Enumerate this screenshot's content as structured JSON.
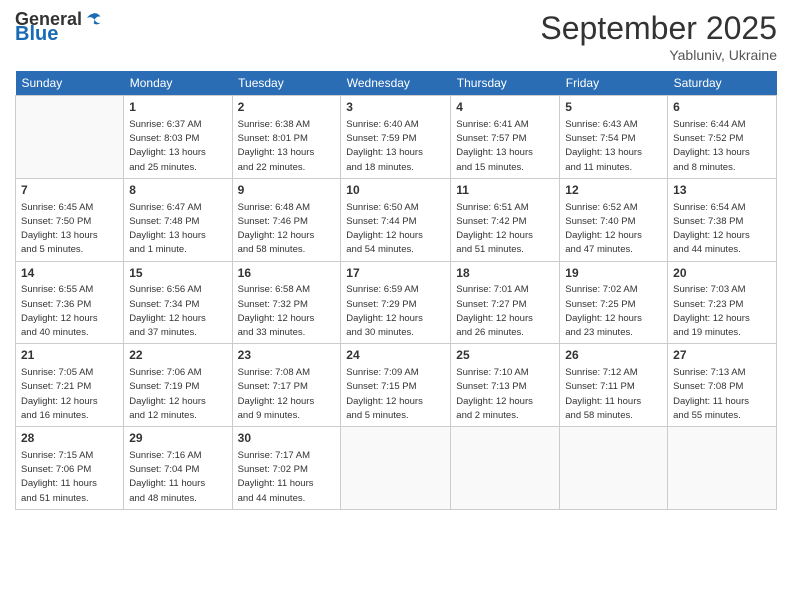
{
  "header": {
    "logo_general": "General",
    "logo_blue": "Blue",
    "month_title": "September 2025",
    "subtitle": "Yabluniv, Ukraine"
  },
  "columns": [
    "Sunday",
    "Monday",
    "Tuesday",
    "Wednesday",
    "Thursday",
    "Friday",
    "Saturday"
  ],
  "weeks": [
    [
      {
        "day": "",
        "info": ""
      },
      {
        "day": "1",
        "info": "Sunrise: 6:37 AM\nSunset: 8:03 PM\nDaylight: 13 hours\nand 25 minutes."
      },
      {
        "day": "2",
        "info": "Sunrise: 6:38 AM\nSunset: 8:01 PM\nDaylight: 13 hours\nand 22 minutes."
      },
      {
        "day": "3",
        "info": "Sunrise: 6:40 AM\nSunset: 7:59 PM\nDaylight: 13 hours\nand 18 minutes."
      },
      {
        "day": "4",
        "info": "Sunrise: 6:41 AM\nSunset: 7:57 PM\nDaylight: 13 hours\nand 15 minutes."
      },
      {
        "day": "5",
        "info": "Sunrise: 6:43 AM\nSunset: 7:54 PM\nDaylight: 13 hours\nand 11 minutes."
      },
      {
        "day": "6",
        "info": "Sunrise: 6:44 AM\nSunset: 7:52 PM\nDaylight: 13 hours\nand 8 minutes."
      }
    ],
    [
      {
        "day": "7",
        "info": "Sunrise: 6:45 AM\nSunset: 7:50 PM\nDaylight: 13 hours\nand 5 minutes."
      },
      {
        "day": "8",
        "info": "Sunrise: 6:47 AM\nSunset: 7:48 PM\nDaylight: 13 hours\nand 1 minute."
      },
      {
        "day": "9",
        "info": "Sunrise: 6:48 AM\nSunset: 7:46 PM\nDaylight: 12 hours\nand 58 minutes."
      },
      {
        "day": "10",
        "info": "Sunrise: 6:50 AM\nSunset: 7:44 PM\nDaylight: 12 hours\nand 54 minutes."
      },
      {
        "day": "11",
        "info": "Sunrise: 6:51 AM\nSunset: 7:42 PM\nDaylight: 12 hours\nand 51 minutes."
      },
      {
        "day": "12",
        "info": "Sunrise: 6:52 AM\nSunset: 7:40 PM\nDaylight: 12 hours\nand 47 minutes."
      },
      {
        "day": "13",
        "info": "Sunrise: 6:54 AM\nSunset: 7:38 PM\nDaylight: 12 hours\nand 44 minutes."
      }
    ],
    [
      {
        "day": "14",
        "info": "Sunrise: 6:55 AM\nSunset: 7:36 PM\nDaylight: 12 hours\nand 40 minutes."
      },
      {
        "day": "15",
        "info": "Sunrise: 6:56 AM\nSunset: 7:34 PM\nDaylight: 12 hours\nand 37 minutes."
      },
      {
        "day": "16",
        "info": "Sunrise: 6:58 AM\nSunset: 7:32 PM\nDaylight: 12 hours\nand 33 minutes."
      },
      {
        "day": "17",
        "info": "Sunrise: 6:59 AM\nSunset: 7:29 PM\nDaylight: 12 hours\nand 30 minutes."
      },
      {
        "day": "18",
        "info": "Sunrise: 7:01 AM\nSunset: 7:27 PM\nDaylight: 12 hours\nand 26 minutes."
      },
      {
        "day": "19",
        "info": "Sunrise: 7:02 AM\nSunset: 7:25 PM\nDaylight: 12 hours\nand 23 minutes."
      },
      {
        "day": "20",
        "info": "Sunrise: 7:03 AM\nSunset: 7:23 PM\nDaylight: 12 hours\nand 19 minutes."
      }
    ],
    [
      {
        "day": "21",
        "info": "Sunrise: 7:05 AM\nSunset: 7:21 PM\nDaylight: 12 hours\nand 16 minutes."
      },
      {
        "day": "22",
        "info": "Sunrise: 7:06 AM\nSunset: 7:19 PM\nDaylight: 12 hours\nand 12 minutes."
      },
      {
        "day": "23",
        "info": "Sunrise: 7:08 AM\nSunset: 7:17 PM\nDaylight: 12 hours\nand 9 minutes."
      },
      {
        "day": "24",
        "info": "Sunrise: 7:09 AM\nSunset: 7:15 PM\nDaylight: 12 hours\nand 5 minutes."
      },
      {
        "day": "25",
        "info": "Sunrise: 7:10 AM\nSunset: 7:13 PM\nDaylight: 12 hours\nand 2 minutes."
      },
      {
        "day": "26",
        "info": "Sunrise: 7:12 AM\nSunset: 7:11 PM\nDaylight: 11 hours\nand 58 minutes."
      },
      {
        "day": "27",
        "info": "Sunrise: 7:13 AM\nSunset: 7:08 PM\nDaylight: 11 hours\nand 55 minutes."
      }
    ],
    [
      {
        "day": "28",
        "info": "Sunrise: 7:15 AM\nSunset: 7:06 PM\nDaylight: 11 hours\nand 51 minutes."
      },
      {
        "day": "29",
        "info": "Sunrise: 7:16 AM\nSunset: 7:04 PM\nDaylight: 11 hours\nand 48 minutes."
      },
      {
        "day": "30",
        "info": "Sunrise: 7:17 AM\nSunset: 7:02 PM\nDaylight: 11 hours\nand 44 minutes."
      },
      {
        "day": "",
        "info": ""
      },
      {
        "day": "",
        "info": ""
      },
      {
        "day": "",
        "info": ""
      },
      {
        "day": "",
        "info": ""
      }
    ]
  ]
}
